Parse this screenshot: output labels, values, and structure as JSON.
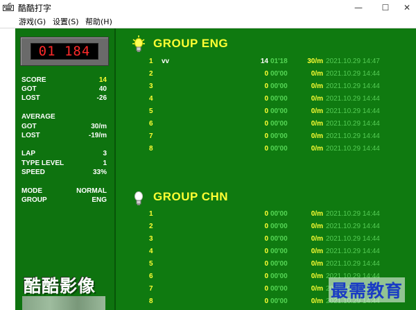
{
  "window": {
    "title": "酷酷打字",
    "minimize": "—",
    "maximize": "☐",
    "close": "✕"
  },
  "menu": [
    {
      "label": "游戏(G)"
    },
    {
      "label": "设置(S)"
    },
    {
      "label": "帮助(H)"
    }
  ],
  "timer": "01 184",
  "stats": {
    "score_label": "SCORE",
    "score": "14",
    "got_label": "GOT",
    "got": "40",
    "lost_label": "LOST",
    "lost": "-26",
    "average_label": "AVERAGE",
    "avg_got_label": "GOT",
    "avg_got": "30/m",
    "avg_lost_label": "LOST",
    "avg_lost": "-19/m",
    "lap_label": "LAP",
    "lap": "3",
    "type_level_label": "TYPE LEVEL",
    "type_level": "1",
    "speed_label": "SPEED",
    "speed": "33%",
    "mode_label": "MODE",
    "mode": "NORMAL",
    "group_label": "GROUP",
    "group": "ENG"
  },
  "logo": "酷酷影像",
  "groups": [
    {
      "title": "GROUP ENG",
      "icon": "lightbulb-on-icon",
      "rows": [
        {
          "rank": "1",
          "name": "vv",
          "score": "14",
          "time": "01'18",
          "speed": "30/m",
          "date": "2021.10.29 14:47"
        },
        {
          "rank": "2",
          "name": "",
          "score": "0",
          "time": "00'00",
          "speed": "0/m",
          "date": "2021.10.29 14:44"
        },
        {
          "rank": "3",
          "name": "",
          "score": "0",
          "time": "00'00",
          "speed": "0/m",
          "date": "2021.10.29 14:44"
        },
        {
          "rank": "4",
          "name": "",
          "score": "0",
          "time": "00'00",
          "speed": "0/m",
          "date": "2021.10.29 14:44"
        },
        {
          "rank": "5",
          "name": "",
          "score": "0",
          "time": "00'00",
          "speed": "0/m",
          "date": "2021.10.29 14:44"
        },
        {
          "rank": "6",
          "name": "",
          "score": "0",
          "time": "00'00",
          "speed": "0/m",
          "date": "2021.10.29 14:44"
        },
        {
          "rank": "7",
          "name": "",
          "score": "0",
          "time": "00'00",
          "speed": "0/m",
          "date": "2021.10.29 14:44"
        },
        {
          "rank": "8",
          "name": "",
          "score": "0",
          "time": "00'00",
          "speed": "0/m",
          "date": "2021.10.29 14:44"
        }
      ]
    },
    {
      "title": "GROUP CHN",
      "icon": "lightbulb-off-icon",
      "rows": [
        {
          "rank": "1",
          "name": "",
          "score": "0",
          "time": "00'00",
          "speed": "0/m",
          "date": "2021.10.29 14:44"
        },
        {
          "rank": "2",
          "name": "",
          "score": "0",
          "time": "00'00",
          "speed": "0/m",
          "date": "2021.10.29 14:44"
        },
        {
          "rank": "3",
          "name": "",
          "score": "0",
          "time": "00'00",
          "speed": "0/m",
          "date": "2021.10.29 14:44"
        },
        {
          "rank": "4",
          "name": "",
          "score": "0",
          "time": "00'00",
          "speed": "0/m",
          "date": "2021.10.29 14:44"
        },
        {
          "rank": "5",
          "name": "",
          "score": "0",
          "time": "00'00",
          "speed": "0/m",
          "date": "2021.10.29 14:44"
        },
        {
          "rank": "6",
          "name": "",
          "score": "0",
          "time": "00'00",
          "speed": "0/m",
          "date": "2021.10.29 14:44"
        },
        {
          "rank": "7",
          "name": "",
          "score": "0",
          "time": "00'00",
          "speed": "0/m",
          "date": "2021.10.29 14:44"
        },
        {
          "rank": "8",
          "name": "",
          "score": "0",
          "time": "00'00",
          "speed": "0/m",
          "date": "2021.10.29 14:44"
        }
      ]
    }
  ],
  "watermark": "最需教育",
  "colors": {
    "background_green": "#0f7a10",
    "highlight_yellow": "#ffff33",
    "time_green": "#55d655",
    "led_red": "#ff2a2a"
  }
}
